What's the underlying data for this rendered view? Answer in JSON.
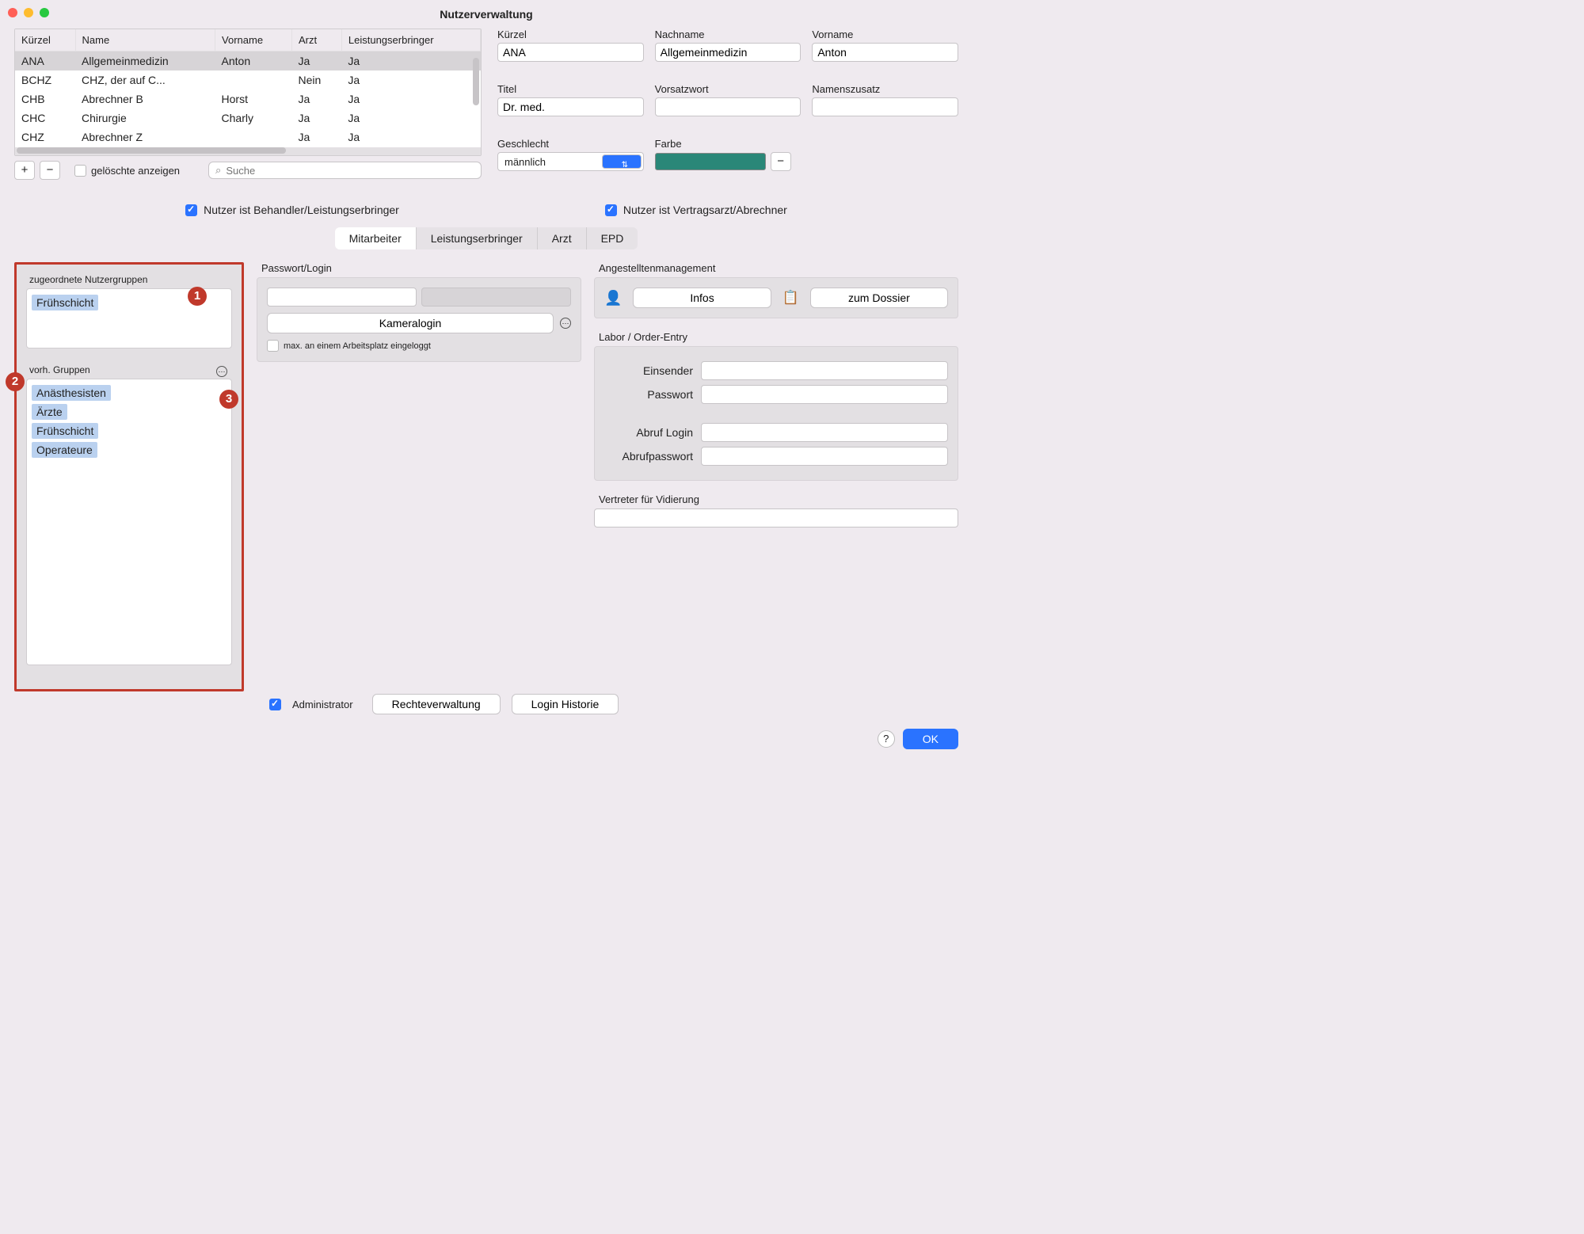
{
  "title": "Nutzerverwaltung",
  "table": {
    "headers": [
      "Kürzel",
      "Name",
      "Vorname",
      "Arzt",
      "Leistungserbringer"
    ],
    "rows": [
      {
        "k": "ANA",
        "n": "Allgemeinmedizin",
        "v": "Anton",
        "a": "Ja",
        "l": "Ja",
        "sel": true
      },
      {
        "k": "BCHZ",
        "n": "CHZ, der auf C...",
        "v": "",
        "a": "Nein",
        "l": "Ja"
      },
      {
        "k": "CHB",
        "n": "Abrechner B",
        "v": "Horst",
        "a": "Ja",
        "l": "Ja"
      },
      {
        "k": "CHC",
        "n": "Chirurgie",
        "v": "Charly",
        "a": "Ja",
        "l": "Ja"
      },
      {
        "k": "CHZ",
        "n": "Abrechner Z",
        "v": "",
        "a": "Ja",
        "l": "Ja"
      }
    ]
  },
  "toolbar": {
    "add": "+",
    "remove": "−",
    "showDeleted": "gelöschte anzeigen",
    "searchPlaceholder": "Suche"
  },
  "details": {
    "kuerzel_l": "Kürzel",
    "kuerzel": "ANA",
    "nachname_l": "Nachname",
    "nachname": "Allgemeinmedizin",
    "vorname_l": "Vorname",
    "vorname": "Anton",
    "titel_l": "Titel",
    "titel": "Dr. med.",
    "vorsatz_l": "Vorsatzwort",
    "vorsatz": "",
    "zusatz_l": "Namenszusatz",
    "zusatz": "",
    "geschl_l": "Geschlecht",
    "geschl": "männlich",
    "farbe_l": "Farbe",
    "farbe": "#2a8778"
  },
  "flags": {
    "behandler": "Nutzer ist Behandler/Leistungserbringer",
    "vertragsarzt": "Nutzer ist Vertragsarzt/Abrechner"
  },
  "tabs": [
    "Mitarbeiter",
    "Leistungserbringer",
    "Arzt",
    "EPD"
  ],
  "active_tab": 0,
  "groups": {
    "assigned_l": "zugeordnete Nutzergruppen",
    "assigned": [
      "Frühschicht"
    ],
    "available_l": "vorh. Gruppen",
    "available": [
      "Anästhesisten",
      "Ärzte",
      "Frühschicht",
      "Operateure"
    ]
  },
  "callouts": [
    "1",
    "2",
    "3"
  ],
  "password": {
    "legend": "Passwort/Login",
    "kameralogin": "Kameralogin",
    "max_one": "max. an einem Arbeitsplatz eingeloggt"
  },
  "angestellt": {
    "legend": "Angestelltenmanagement",
    "infos": "Infos",
    "dossier": "zum Dossier"
  },
  "labor": {
    "legend": "Labor / Order-Entry",
    "einsender": "Einsender",
    "passwort": "Passwort",
    "abruf_login": "Abruf Login",
    "abruf_pw": "Abrufpasswort"
  },
  "vertreter_l": "Vertreter für Vidierung",
  "admin_l": "Administrator",
  "rechte": "Rechteverwaltung",
  "historie": "Login Historie",
  "ok": "OK",
  "help": "?"
}
